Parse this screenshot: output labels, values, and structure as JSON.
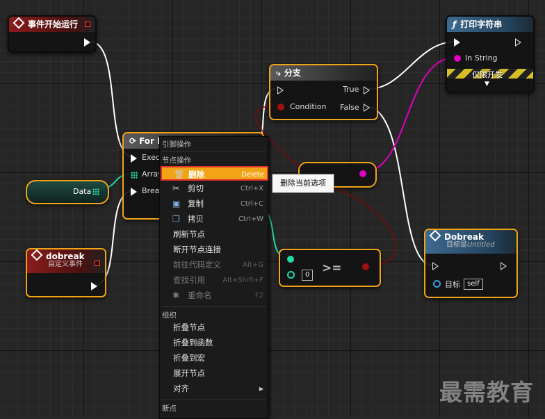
{
  "nodes": {
    "event_begin": {
      "title": "事件开始运行"
    },
    "branch": {
      "title": "分支",
      "pins": {
        "condition": "Condition",
        "true": "True",
        "false": "False"
      }
    },
    "print_string": {
      "title": "打印字符串",
      "pins": {
        "in_string": "In String"
      },
      "dev_only": "仅限开发"
    },
    "foreach": {
      "title": "For Each Loop with Break",
      "pins": {
        "exec": "Exec",
        "array": "Array",
        "break": "Break"
      }
    },
    "data_var": {
      "label": "Data"
    },
    "dobreak_event": {
      "title": "dobreak",
      "subtitle": "自定义事件"
    },
    "compare": {
      "op": ">=",
      "value": "0"
    },
    "dobreak_call": {
      "title": "Dobreak",
      "subtitle_prefix": "目标是",
      "subtitle_target": "Untitled",
      "target_label": "目标",
      "target_value": "self"
    }
  },
  "context_menu": {
    "sections": {
      "pin_actions": "引脚操作",
      "node_actions": "节点操作",
      "organization": "组织",
      "breakpoints": "断点"
    },
    "items": [
      {
        "label": "删除",
        "shortcut": "Delete",
        "icon": "delete-icon"
      },
      {
        "label": "剪切",
        "shortcut": "Ctrl+X",
        "icon": "scissors-icon"
      },
      {
        "label": "复制",
        "shortcut": "Ctrl+C",
        "icon": "copy-icon"
      },
      {
        "label": "拷贝",
        "shortcut": "Ctrl+W",
        "icon": "duplicate-icon"
      },
      {
        "label": "刷新节点",
        "shortcut": ""
      },
      {
        "label": "断开节点连接",
        "shortcut": ""
      },
      {
        "label": "前往代码定义",
        "shortcut": "Alt+G"
      },
      {
        "label": "查找引用",
        "shortcut": "Alt+Shift+F"
      },
      {
        "label": "重命名",
        "shortcut": "F2",
        "icon": "rename-icon"
      },
      {
        "label": "折叠节点",
        "shortcut": ""
      },
      {
        "label": "折叠到函数",
        "shortcut": ""
      },
      {
        "label": "折叠到宏",
        "shortcut": ""
      },
      {
        "label": "展开节点",
        "shortcut": ""
      },
      {
        "label": "对齐",
        "shortcut": "",
        "submenu": true
      }
    ]
  },
  "tooltip": "删除当前选项",
  "watermark": "最需教育",
  "colors": {
    "selection": "#f2a417",
    "highlight_border": "#e03030",
    "exec_wire": "#ffffff",
    "string_wire": "#ff00d0",
    "bool_wire": "#8b0000",
    "struct_wire": "#25d8a8"
  }
}
